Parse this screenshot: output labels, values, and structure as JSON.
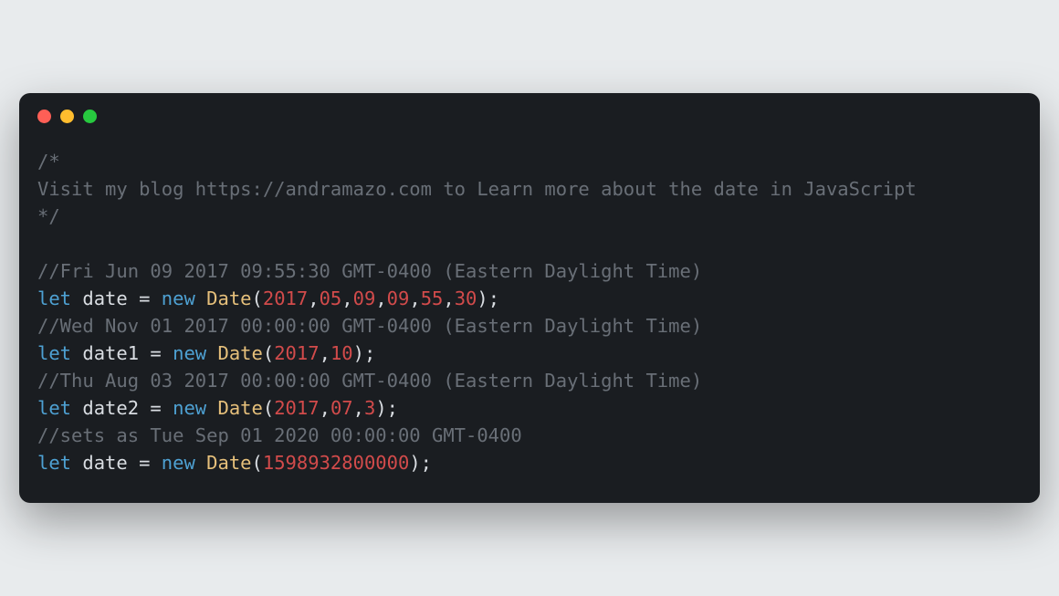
{
  "window": {
    "traffic_lights": [
      "close",
      "minimize",
      "zoom"
    ]
  },
  "code": {
    "block_comment_open": "/*",
    "block_comment_line": "Visit my blog https://andramazo.com to Learn more about the date in JavaScript",
    "block_comment_close": "*/",
    "lines": [
      {
        "comment": "//Fri Jun 09 2017 09:55:30 GMT-0400 (Eastern Daylight Time)",
        "kw_let": "let",
        "ident": "date",
        "eq": " = ",
        "kw_new": "new",
        "sp": " ",
        "class": "Date",
        "op_open": "(",
        "args": [
          {
            "v": "2017",
            "sep": ","
          },
          {
            "v": "05",
            "sep": ","
          },
          {
            "v": "09",
            "sep": ","
          },
          {
            "v": "09",
            "sep": ","
          },
          {
            "v": "55",
            "sep": ","
          },
          {
            "v": "30",
            "sep": ""
          }
        ],
        "op_close": ");"
      },
      {
        "comment": "//Wed Nov 01 2017 00:00:00 GMT-0400 (Eastern Daylight Time)",
        "kw_let": "let",
        "ident": "date1",
        "eq": " = ",
        "kw_new": "new",
        "sp": " ",
        "class": "Date",
        "op_open": "(",
        "args": [
          {
            "v": "2017",
            "sep": ","
          },
          {
            "v": "10",
            "sep": ""
          }
        ],
        "op_close": ");"
      },
      {
        "comment": "//Thu Aug 03 2017 00:00:00 GMT-0400 (Eastern Daylight Time)",
        "kw_let": "let",
        "ident": "date2",
        "eq": " = ",
        "kw_new": "new",
        "sp": " ",
        "class": "Date",
        "op_open": "(",
        "args": [
          {
            "v": "2017",
            "sep": ","
          },
          {
            "v": "07",
            "sep": ","
          },
          {
            "v": "3",
            "sep": ""
          }
        ],
        "op_close": ");"
      },
      {
        "comment": "//sets as Tue Sep 01 2020 00:00:00 GMT-0400",
        "kw_let": "let",
        "ident": "date",
        "eq": " = ",
        "kw_new": "new",
        "sp": " ",
        "class": "Date",
        "op_open": "(",
        "args": [
          {
            "v": "1598932800000",
            "sep": ""
          }
        ],
        "op_close": ");"
      }
    ]
  }
}
